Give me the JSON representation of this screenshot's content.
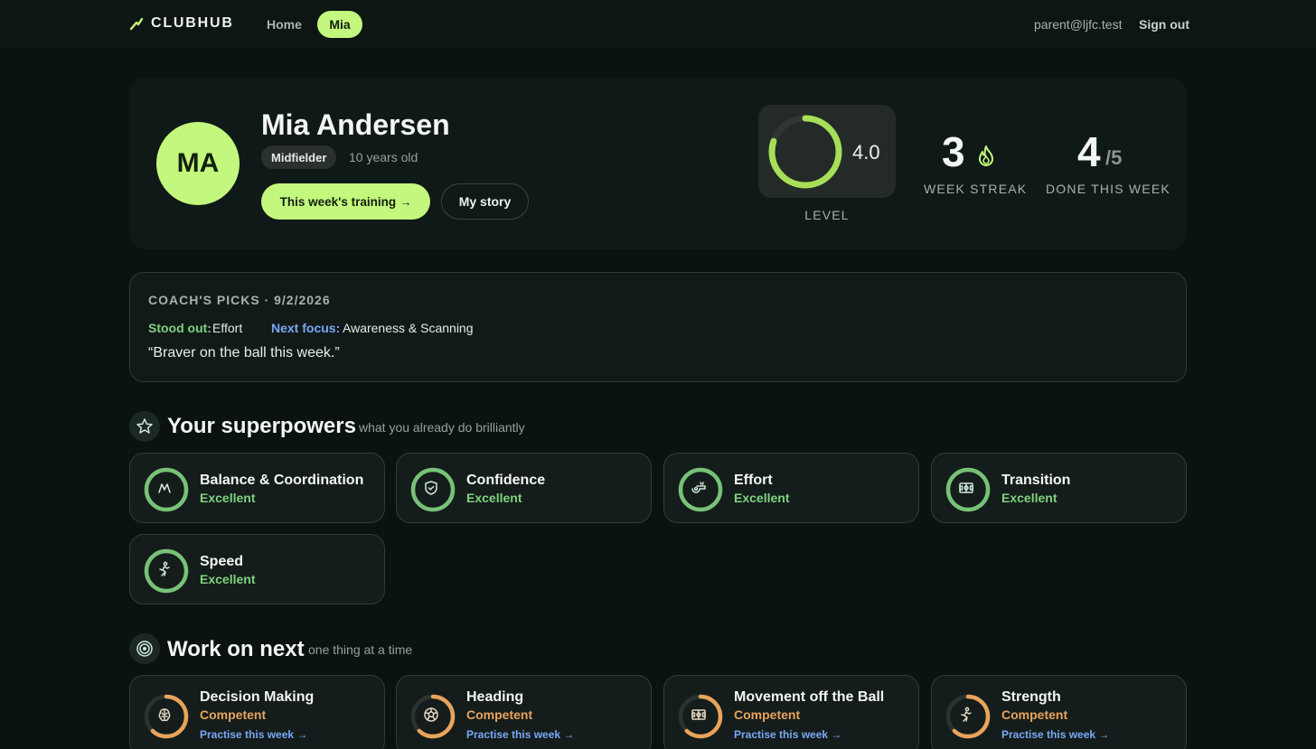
{
  "nav": {
    "brand": "CLUBHUB",
    "home": "Home",
    "active_child": "Mia",
    "user_email": "parent@ljfc.test",
    "sign_out": "Sign out"
  },
  "player": {
    "initials": "MA",
    "name": "Mia Andersen",
    "position": "Midfielder",
    "age": "10 years old",
    "training_button": "This week's training →",
    "story_button": "My story"
  },
  "stats": {
    "level_value": "4.0",
    "level_label": "LEVEL",
    "level_progress": 0.8,
    "streak_value": "3",
    "streak_label": "WEEK STREAK",
    "done_value": "4",
    "done_total": "/5",
    "done_label": "DONE THIS WEEK"
  },
  "coach": {
    "title": "COACH'S PICKS · 9/2/2026",
    "stood_out_key": "Stood out:",
    "stood_out_value": "Effort",
    "next_focus_key": "Next focus:",
    "next_focus_value": "Awareness & Scanning",
    "quote": "“Braver on the ball this week.”"
  },
  "superpowers": {
    "title": "Your superpowers",
    "subtitle": "what you already do brilliantly",
    "items": [
      {
        "name": "Balance & Coordination",
        "level": "Excellent",
        "icon": "balance-icon"
      },
      {
        "name": "Confidence",
        "level": "Excellent",
        "icon": "shield-icon"
      },
      {
        "name": "Effort",
        "level": "Excellent",
        "icon": "whistle-icon"
      },
      {
        "name": "Transition",
        "level": "Excellent",
        "icon": "pitch-icon"
      },
      {
        "name": "Speed",
        "level": "Excellent",
        "icon": "runner-icon"
      }
    ]
  },
  "work_on_next": {
    "title": "Work on next",
    "subtitle": "one thing at a time",
    "items": [
      {
        "name": "Decision Making",
        "level": "Competent",
        "link": "Practise this week →",
        "icon": "brain-icon"
      },
      {
        "name": "Heading",
        "level": "Competent",
        "link": "Practise this week →",
        "icon": "ball-icon"
      },
      {
        "name": "Movement off the Ball",
        "level": "Competent",
        "link": "Practise this week →",
        "icon": "pitch-icon"
      },
      {
        "name": "Strength",
        "level": "Competent",
        "link": "Practise this week →",
        "icon": "runner-icon"
      }
    ]
  },
  "colors": {
    "accent": "#c4f77d",
    "excellent": "#7fd17f",
    "competent": "#e8a35c",
    "link": "#79a8f5",
    "background": "#0b1311"
  }
}
